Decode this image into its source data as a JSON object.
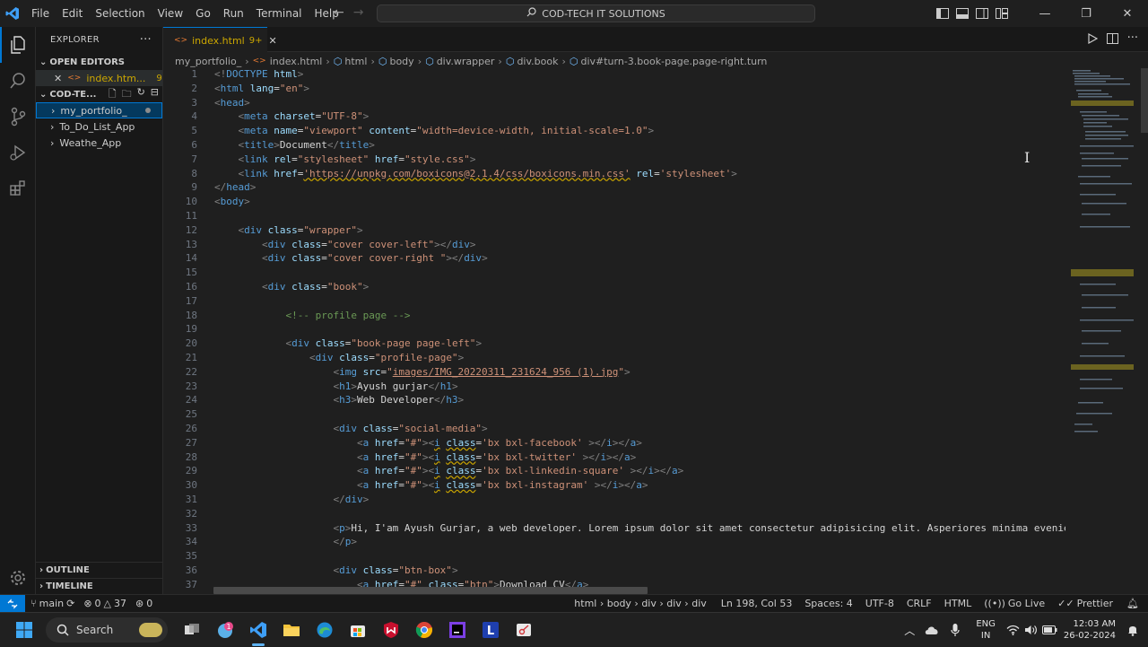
{
  "titlebar": {
    "menu": [
      "File",
      "Edit",
      "Selection",
      "View",
      "Go",
      "Run",
      "Terminal",
      "Help"
    ],
    "command_center": "COD-TECH IT SOLUTIONS",
    "window_controls": [
      "minimize",
      "maximize",
      "close"
    ]
  },
  "sidebar": {
    "header": "EXPLORER",
    "open_editors_label": "OPEN EDITORS",
    "open_editor_file": "index.htm...",
    "open_editor_badge": "9+",
    "workspace_label": "COD-TE...",
    "folders": [
      "my_portfolio_",
      "To_Do_List_App",
      "Weathe_App"
    ],
    "outline_label": "OUTLINE",
    "timeline_label": "TIMELINE"
  },
  "tab": {
    "name": "index.html",
    "badge": "9+"
  },
  "breadcrumbs": [
    "my_portfolio_",
    "index.html",
    "html",
    "body",
    "div.wrapper",
    "div.book",
    "div#turn-3.book-page.page-right.turn"
  ],
  "code_lines": [
    {
      "n": "1",
      "html": "<span class='t-p'>&lt;!</span><span class='t-tag'>DOCTYPE</span> <span class='t-attr'>html</span><span class='t-p'>&gt;</span>"
    },
    {
      "n": "2",
      "html": "<span class='t-p'>&lt;</span><span class='t-tag'>html</span> <span class='t-attr'>lang</span>=<span class='t-str'>\"en\"</span><span class='t-p'>&gt;</span>"
    },
    {
      "n": "3",
      "html": "<span class='t-p'>&lt;</span><span class='t-tag'>head</span><span class='t-p'>&gt;</span>"
    },
    {
      "n": "4",
      "html": "    <span class='t-p'>&lt;</span><span class='t-tag'>meta</span> <span class='t-attr'>charset</span>=<span class='t-str'>\"UTF-8\"</span><span class='t-p'>&gt;</span>"
    },
    {
      "n": "5",
      "html": "    <span class='t-p'>&lt;</span><span class='t-tag'>meta</span> <span class='t-attr'>name</span>=<span class='t-str'>\"viewport\"</span> <span class='t-attr'>content</span>=<span class='t-str'>\"width=device-width, initial-scale=1.0\"</span><span class='t-p'>&gt;</span>"
    },
    {
      "n": "6",
      "html": "    <span class='t-p'>&lt;</span><span class='t-tag'>title</span><span class='t-p'>&gt;</span>Document<span class='t-p'>&lt;/</span><span class='t-tag'>title</span><span class='t-p'>&gt;</span>"
    },
    {
      "n": "7",
      "html": "    <span class='t-p'>&lt;</span><span class='t-tag'>link</span> <span class='t-attr'>rel</span>=<span class='t-str'>\"stylesheet\"</span> <span class='t-attr'>href</span>=<span class='t-str'>\"style.css\"</span><span class='t-p'>&gt;</span>"
    },
    {
      "n": "8",
      "html": "    <span class='t-p'>&lt;</span><span class='t-tag'>link</span> <span class='t-attr'>href</span>=<span class='t-str squig'>'https://unpkg.com/boxicons@2.1.4/css/boxicons.min.css'</span> <span class='t-attr'>rel</span>=<span class='t-str'>'stylesheet'</span><span class='t-p'>&gt;</span>"
    },
    {
      "n": "9",
      "html": "<span class='t-p'>&lt;/</span><span class='t-tag'>head</span><span class='t-p'>&gt;</span>"
    },
    {
      "n": "10",
      "html": "<span class='t-p'>&lt;</span><span class='t-tag'>body</span><span class='t-p'>&gt;</span>"
    },
    {
      "n": "11",
      "html": ""
    },
    {
      "n": "12",
      "html": "    <span class='t-p'>&lt;</span><span class='t-tag'>div</span> <span class='t-attr'>class</span>=<span class='t-str'>\"wrapper\"</span><span class='t-p'>&gt;</span>"
    },
    {
      "n": "13",
      "html": "        <span class='t-p'>&lt;</span><span class='t-tag'>div</span> <span class='t-attr'>class</span>=<span class='t-str'>\"cover cover-left\"</span><span class='t-p'>&gt;&lt;/</span><span class='t-tag'>div</span><span class='t-p'>&gt;</span>"
    },
    {
      "n": "14",
      "html": "        <span class='t-p'>&lt;</span><span class='t-tag'>div</span> <span class='t-attr'>class</span>=<span class='t-str'>\"cover cover-right \"</span><span class='t-p'>&gt;&lt;/</span><span class='t-tag'>div</span><span class='t-p'>&gt;</span>"
    },
    {
      "n": "15",
      "html": ""
    },
    {
      "n": "16",
      "html": "        <span class='t-p'>&lt;</span><span class='t-tag'>div</span> <span class='t-attr'>class</span>=<span class='t-str'>\"book\"</span><span class='t-p'>&gt;</span>"
    },
    {
      "n": "17",
      "html": ""
    },
    {
      "n": "18",
      "html": "            <span class='t-cm'>&lt;!-- profile page --&gt;</span>"
    },
    {
      "n": "19",
      "html": ""
    },
    {
      "n": "20",
      "html": "            <span class='t-p'>&lt;</span><span class='t-tag'>div</span> <span class='t-attr'>class</span>=<span class='t-str'>\"book-page page-left\"</span><span class='t-p'>&gt;</span>"
    },
    {
      "n": "21",
      "html": "                <span class='t-p'>&lt;</span><span class='t-tag'>div</span> <span class='t-attr'>class</span>=<span class='t-str'>\"profile-page\"</span><span class='t-p'>&gt;</span>"
    },
    {
      "n": "22",
      "html": "                    <span class='t-p'>&lt;</span><span class='t-tag'>img</span> <span class='t-attr'>src</span>=<span class='t-str'>\"<u>images/IMG_20220311_231624_956 (1).jpg</u>\"</span><span class='t-p'>&gt;</span>"
    },
    {
      "n": "23",
      "html": "                    <span class='t-p'>&lt;</span><span class='t-tag'>h1</span><span class='t-p'>&gt;</span>Ayush gurjar<span class='t-p'>&lt;/</span><span class='t-tag'>h1</span><span class='t-p'>&gt;</span>"
    },
    {
      "n": "24",
      "html": "                    <span class='t-p'>&lt;</span><span class='t-tag'>h3</span><span class='t-p'>&gt;</span>Web Developer<span class='t-p'>&lt;/</span><span class='t-tag'>h3</span><span class='t-p'>&gt;</span>"
    },
    {
      "n": "25",
      "html": ""
    },
    {
      "n": "26",
      "html": "                    <span class='t-p'>&lt;</span><span class='t-tag'>div</span> <span class='t-attr'>class</span>=<span class='t-str'>\"social-media\"</span><span class='t-p'>&gt;</span>"
    },
    {
      "n": "27",
      "html": "                        <span class='t-p'>&lt;</span><span class='t-tag'>a</span> <span class='t-attr'>href</span>=<span class='t-str'>\"#\"</span><span class='t-p'>&gt;&lt;</span><span class='t-tag squig'>i</span> <span class='t-attr squig'>class</span>=<span class='t-str'>'bx bxl-facebook'</span> <span class='t-p'>&gt;&lt;/</span><span class='t-tag'>i</span><span class='t-p'>&gt;&lt;/</span><span class='t-tag'>a</span><span class='t-p'>&gt;</span>"
    },
    {
      "n": "28",
      "html": "                        <span class='t-p'>&lt;</span><span class='t-tag'>a</span> <span class='t-attr'>href</span>=<span class='t-str'>\"#\"</span><span class='t-p'>&gt;&lt;</span><span class='t-tag squig'>i</span> <span class='t-attr squig'>class</span>=<span class='t-str'>'bx bxl-twitter'</span> <span class='t-p'>&gt;&lt;/</span><span class='t-tag'>i</span><span class='t-p'>&gt;&lt;/</span><span class='t-tag'>a</span><span class='t-p'>&gt;</span>"
    },
    {
      "n": "29",
      "html": "                        <span class='t-p'>&lt;</span><span class='t-tag'>a</span> <span class='t-attr'>href</span>=<span class='t-str'>\"#\"</span><span class='t-p'>&gt;&lt;</span><span class='t-tag squig'>i</span> <span class='t-attr squig'>class</span>=<span class='t-str'>'bx bxl-linkedin-square'</span> <span class='t-p'>&gt;&lt;/</span><span class='t-tag'>i</span><span class='t-p'>&gt;&lt;/</span><span class='t-tag'>a</span><span class='t-p'>&gt;</span>"
    },
    {
      "n": "30",
      "html": "                        <span class='t-p'>&lt;</span><span class='t-tag'>a</span> <span class='t-attr'>href</span>=<span class='t-str'>\"#\"</span><span class='t-p'>&gt;&lt;</span><span class='t-tag squig'>i</span> <span class='t-attr squig'>class</span>=<span class='t-str'>'bx bxl-instagram'</span> <span class='t-p'>&gt;&lt;/</span><span class='t-tag'>i</span><span class='t-p'>&gt;&lt;/</span><span class='t-tag'>a</span><span class='t-p'>&gt;</span>"
    },
    {
      "n": "31",
      "html": "                    <span class='t-p'>&lt;/</span><span class='t-tag'>div</span><span class='t-p'>&gt;</span>"
    },
    {
      "n": "32",
      "html": ""
    },
    {
      "n": "33",
      "html": "                    <span class='t-p'>&lt;</span><span class='t-tag'>p</span><span class='t-p'>&gt;</span>Hi, I'am Ayush Gurjar, a web developer. Lorem ipsum dolor sit amet consectetur adipisicing elit. Asperiores minima eveniet fu"
    },
    {
      "n": "34",
      "html": "                    <span class='t-p'>&lt;/</span><span class='t-tag'>p</span><span class='t-p'>&gt;</span>"
    },
    {
      "n": "35",
      "html": ""
    },
    {
      "n": "36",
      "html": "                    <span class='t-p'>&lt;</span><span class='t-tag'>div</span> <span class='t-attr'>class</span>=<span class='t-str'>\"btn-box\"</span><span class='t-p'>&gt;</span>"
    },
    {
      "n": "37",
      "html": "                        <span class='t-p'>&lt;</span><span class='t-tag'>a</span> <span class='t-attr'>href</span>=<span class='t-str'>\"#\"</span> <span class='t-attr'>class</span>=<span class='t-str'>\"btn\"</span><span class='t-p'>&gt;</span>Download CV<span class='t-p'>&lt;/</span><span class='t-tag'>a</span><span class='t-p'>&gt;</span>"
    }
  ],
  "statusbar": {
    "branch": "main",
    "errors": "0",
    "warnings": "37",
    "ports": "0",
    "path": "html › body › div › div › div",
    "position": "Ln 198, Col 53",
    "spaces": "Spaces: 4",
    "encoding": "UTF-8",
    "eol": "CRLF",
    "language": "HTML",
    "golive": "Go Live",
    "prettier": "Prettier"
  },
  "taskbar": {
    "search": "Search",
    "lang_top": "ENG",
    "lang_bottom": "IN",
    "time": "12:03 AM",
    "date": "26-02-2024"
  }
}
